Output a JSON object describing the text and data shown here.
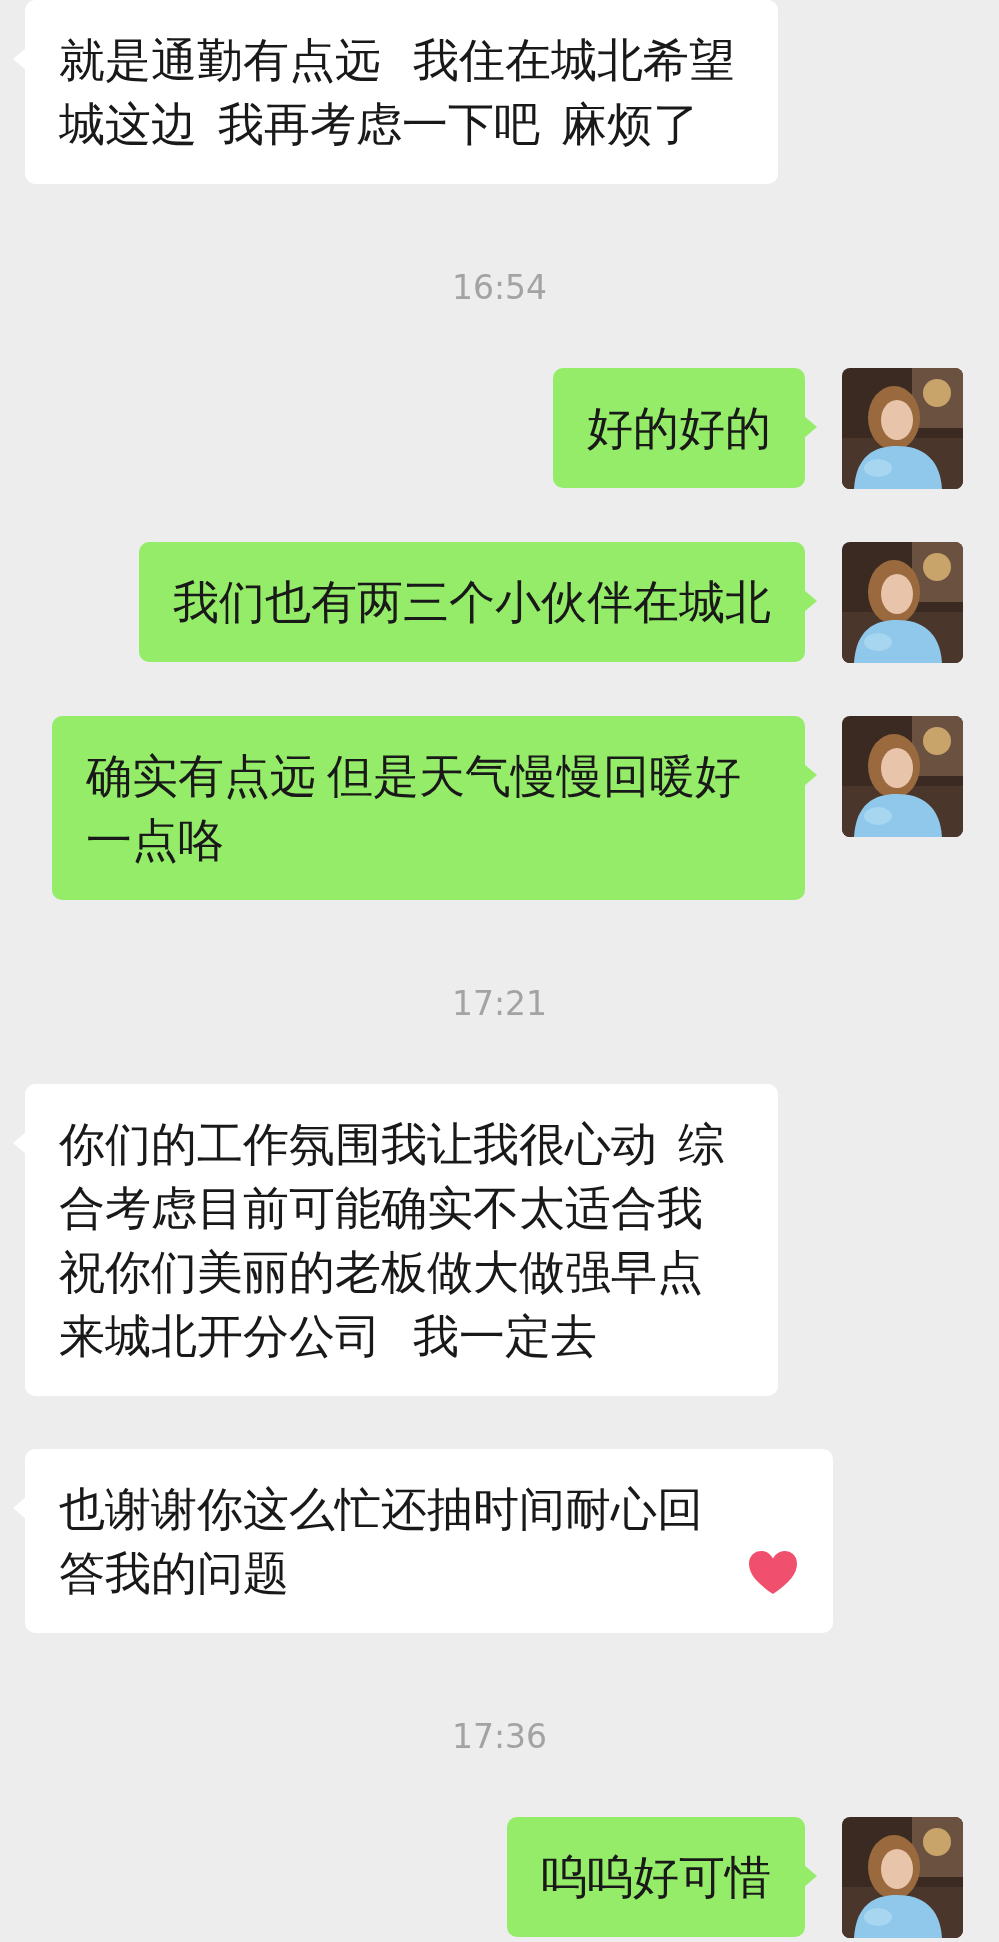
{
  "messages": [
    {
      "kind": "incoming",
      "text": "就是通勤有点远   我住在城北希望城这边  我再考虑一下吧  麻烦了"
    },
    {
      "kind": "time",
      "text": "16:54"
    },
    {
      "kind": "outgoing",
      "text": "好的好的"
    },
    {
      "kind": "outgoing",
      "text": "我们也有两三个小伙伴在城北"
    },
    {
      "kind": "outgoing",
      "text": "确实有点远 但是天气慢慢回暖好一点咯"
    },
    {
      "kind": "time",
      "text": "17:21"
    },
    {
      "kind": "incoming",
      "text": "你们的工作氛围我让我很心动  综合考虑目前可能确实不太适合我祝你们美丽的老板做大做强早点来城北开分公司   我一定去"
    },
    {
      "kind": "incoming_heart",
      "text": "也谢谢你这么忙还抽时间耐心回答我的问题"
    },
    {
      "kind": "time",
      "text": "17:36"
    },
    {
      "kind": "outgoing",
      "text": "呜呜好可惜"
    }
  ]
}
